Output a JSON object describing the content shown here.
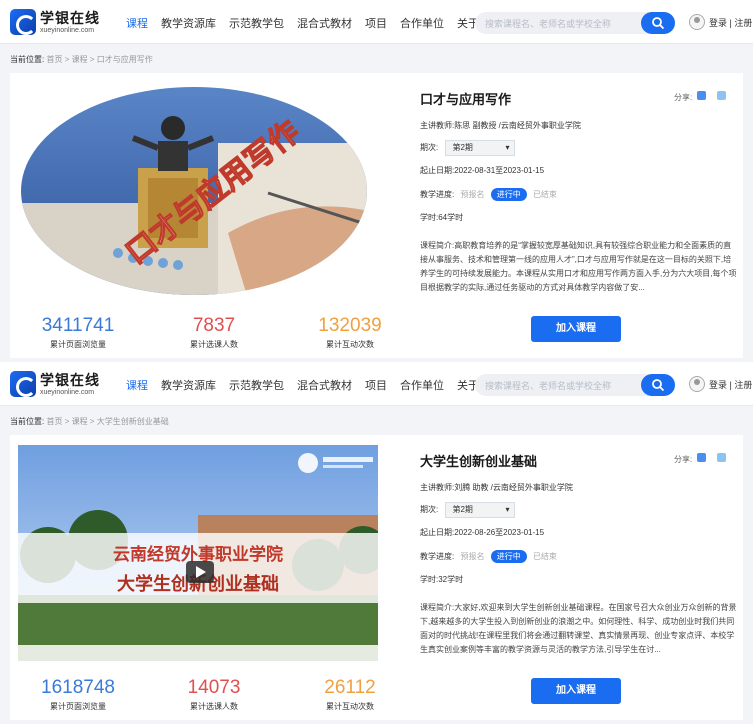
{
  "colors": {
    "accent": "#1a6cf0",
    "stat_blue": "#3a7ad8",
    "stat_red": "#e05050",
    "stat_orange": "#f0a040"
  },
  "header": {
    "brand": "学银在线",
    "brand_sub": "xueyinonline.com",
    "nav": [
      "课程",
      "教学资源库",
      "示范教学包",
      "混合式教材",
      "项目",
      "合作单位",
      "关于我们"
    ],
    "search_placeholder": "搜索课程名、老师名或学校全称",
    "auth": "登录 | 注册"
  },
  "labels": {
    "crumb_prefix": "当前位置:",
    "share": "分享:",
    "stat_views": "累计页面浏览量",
    "stat_students": "累计选课人数",
    "stat_interactions": "累计互动次数",
    "join": "加入课程",
    "stage_pre": "预报名",
    "stage_on": "进行中",
    "stage_done": "已结束"
  },
  "courses": [
    {
      "breadcrumb": "首页 > 课程 > 口才与应用写作",
      "title": "口才与应用写作",
      "cover_text": "口才与应用写作",
      "teacher": "主讲教师:陈思 副教授 /云南经贸外事职业学院",
      "term_label": "期次:",
      "term": "第2期",
      "dates": "起止日期:2022-08-31至2023-01-15",
      "progress_label": "教学进度:",
      "hours": "学时:64学时",
      "intro": "课程简介:高职教育培养的是“掌握较宽厚基础知识,具有较强综合职业能力和全面素质的直接从事服务、技术和管理第一线的应用人才”,口才与应用写作就是在这一目标的关照下,培养学生的可持续发展能力。本课程从实用口才和应用写作两方面入手,分为六大项目,每个项目根据教学的实际,通过任务驱动的方式对具体教学内容做了安...",
      "views": "3411741",
      "students": "7837",
      "interactions": "132039"
    },
    {
      "breadcrumb": "首页 > 课程 > 大学生创新创业基础",
      "title": "大学生创新创业基础",
      "cover_school": "云南经贸外事职业学院",
      "cover_course": "大学生创新创业基础",
      "teacher": "主讲教师:刘腾 助教 /云南经贸外事职业学院",
      "term_label": "期次:",
      "term": "第2期",
      "dates": "起止日期:2022-08-26至2023-01-15",
      "progress_label": "教学进度:",
      "hours": "学时:32学时",
      "intro": "课程简介:大家好,欢迎来到大学生创新创业基础课程。在国家号召大众创业万众创新的背景下,越来越多的大学生投入到创新创业的浪潮之中。如何理性、科学、成功创业时我们共同面对的时代挑战!在课程里我们将会通过翻转课堂、真实情景再现、创业专家点评、本校学生真实创业案例等丰富的教学资源与灵活的教学方法,引导学生在讨...",
      "views": "1618748",
      "students": "14073",
      "interactions": "26112"
    }
  ]
}
